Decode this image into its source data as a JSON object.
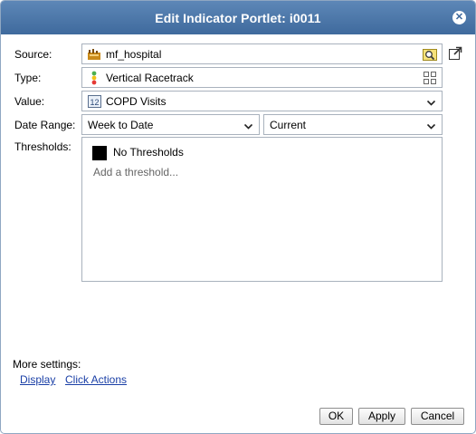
{
  "dialog": {
    "title": "Edit Indicator Portlet: i0011"
  },
  "form": {
    "source_label": "Source:",
    "source_value": "mf_hospital",
    "type_label": "Type:",
    "type_value": "Vertical Racetrack",
    "value_label": "Value:",
    "value_value": "COPD Visits",
    "date_range_label": "Date Range:",
    "date_range_value": "Week to Date",
    "date_period_value": "Current",
    "thresholds_label": "Thresholds:"
  },
  "thresholds": {
    "items": [
      {
        "label": "No Thresholds",
        "color": "#000000"
      }
    ],
    "add_label": "Add a threshold..."
  },
  "more": {
    "label": "More settings:",
    "links": [
      "Display",
      "Click Actions"
    ]
  },
  "buttons": {
    "ok": "OK",
    "apply": "Apply",
    "cancel": "Cancel"
  },
  "icons": {
    "source": "database-icon",
    "source_browse": "search-folder-icon",
    "external": "open-external-icon",
    "type": "racetrack-icon",
    "type_picker": "grid-icon",
    "value": "number-12-icon",
    "close": "close-icon"
  },
  "colors": {
    "titlebar": "#4a76a8",
    "link": "#1a3fa6"
  }
}
